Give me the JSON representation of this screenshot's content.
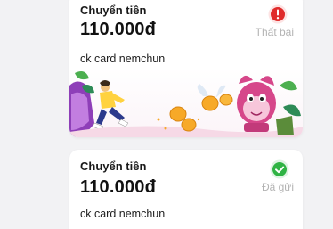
{
  "transactions": [
    {
      "title": "Chuyển tiền",
      "amount": "110.000đ",
      "note": "ck card nemchun",
      "status": "Thất bại",
      "status_icon": "error-icon",
      "status_color": "#e02b2b"
    },
    {
      "title": "Chuyển tiền",
      "amount": "110.000đ",
      "note": "ck card nemchun",
      "status": "Đã gửi",
      "status_icon": "check-icon",
      "status_color": "#2fb344"
    }
  ],
  "colors": {
    "background": "#f2f2f4",
    "card": "#ffffff",
    "error": "#e02b2b",
    "success": "#2fb344",
    "muted": "#b3b3b3"
  }
}
